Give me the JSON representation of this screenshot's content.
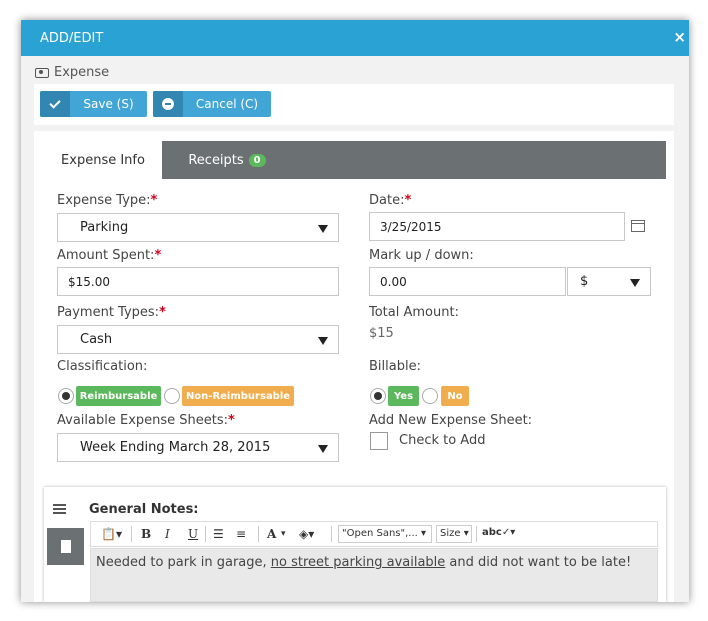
{
  "dialog": {
    "title": "ADD/EDIT",
    "close_label": "×",
    "subtitle": "Expense"
  },
  "toolbar": {
    "save_label": "Save (S)",
    "cancel_label": "Cancel (C)"
  },
  "tabs": [
    {
      "label": "Expense Info",
      "active": true
    },
    {
      "label": "Receipts",
      "badge": "0",
      "active": false
    }
  ],
  "form": {
    "expense_type": {
      "label": "Expense Type:",
      "required": "*",
      "value": "Parking"
    },
    "date": {
      "label": "Date:",
      "required": "*",
      "value": "3/25/2015"
    },
    "amount_spent": {
      "label": "Amount Spent:",
      "required": "*",
      "value": "$15.00"
    },
    "markup": {
      "label": "Mark up / down:",
      "value": "0.00",
      "unit": "$"
    },
    "payment_types": {
      "label": "Payment Types:",
      "required": "*",
      "value": "Cash"
    },
    "total_amount": {
      "label": "Total Amount:",
      "value": "$15"
    },
    "classification": {
      "label": "Classification:",
      "options": [
        "Reimbursable",
        "Non-Reimbursable"
      ],
      "selected": "Reimbursable"
    },
    "billable": {
      "label": "Billable:",
      "options": [
        "Yes",
        "No"
      ],
      "selected": "Yes"
    },
    "expense_sheets": {
      "label": "Available Expense Sheets:",
      "required": "*",
      "value": "Week Ending March 28, 2015"
    },
    "new_sheet": {
      "label": "Add New Expense Sheet:",
      "checkbox_label": "Check to Add",
      "checked": false
    }
  },
  "notes": {
    "title": "General Notes:",
    "toolbar": {
      "bold": "B",
      "italic": "I",
      "underline": "U",
      "font_color": "A",
      "font_family": "\"Open Sans\",...",
      "font_size": "Size"
    },
    "text_before": "Needed to park in garage, ",
    "text_underlined": "no street parking available",
    "text_after": " and did not want to be late!"
  },
  "colors": {
    "accent": "#2aa2d4",
    "button": "#41a5d6",
    "tab_bar": "#6b7173",
    "success": "#5cb85c",
    "warning": "#f0ad4e",
    "required": "#d0021b"
  }
}
